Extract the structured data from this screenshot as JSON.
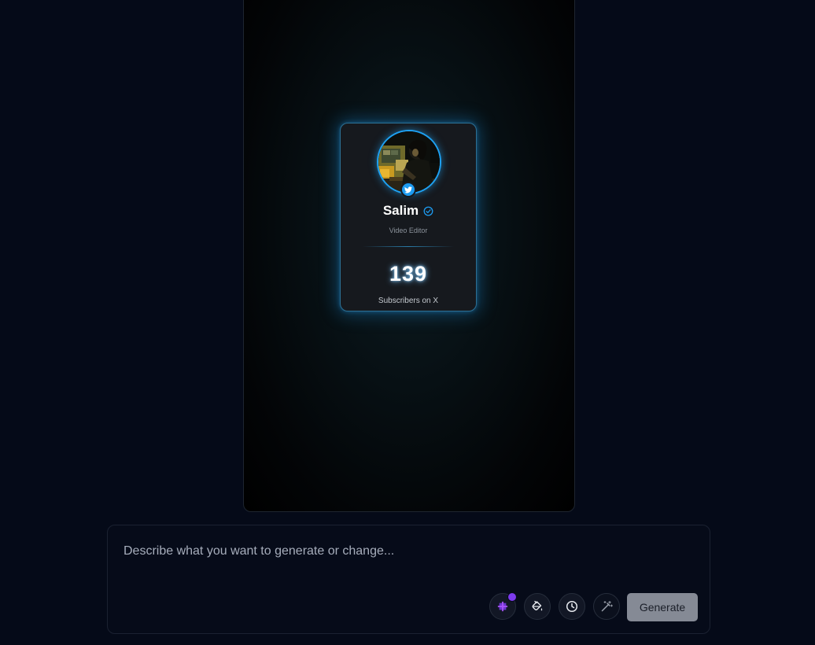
{
  "preview": {
    "card": {
      "name": "Salim",
      "role": "Video Editor",
      "count": "139",
      "count_label": "Subscribers on X",
      "avatar_icon": "user-photo-avatar",
      "badge_icon": "twitter-bird-icon",
      "verified_icon": "verified-check-icon"
    }
  },
  "prompt": {
    "placeholder": "Describe what you want to generate or change...",
    "value": ""
  },
  "toolbar": {
    "buttons": [
      {
        "icon": "sparkle-icon",
        "accent": "#7c3aed"
      },
      {
        "icon": "paint-bucket-icon"
      },
      {
        "icon": "clock-icon"
      },
      {
        "icon": "magic-wand-icon"
      }
    ],
    "generate_label": "Generate"
  },
  "colors": {
    "background": "#050a18",
    "card_glow": "#1e96e6",
    "twitter_blue": "#1d9bf0",
    "generate_button": "#858a95"
  }
}
